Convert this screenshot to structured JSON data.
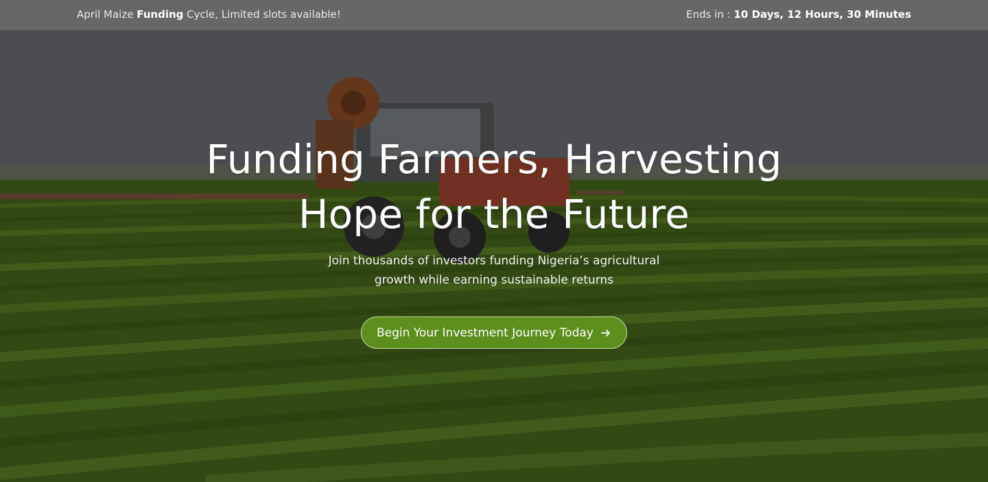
{
  "announcement": {
    "left_prefix": "April Maize ",
    "left_bold": "Funding",
    "left_suffix": " Cycle, Limited slots available!",
    "right_label": "Ends in : ",
    "right_value": "10 Days, 12 Hours, 30 Minutes"
  },
  "hero": {
    "headline_line1": "Funding Farmers, Harvesting",
    "headline_line2": "Hope for the Future",
    "subtext_line1": "Join thousands of investors funding Nigeria’s agricultural",
    "subtext_line2": "growth while earning sustainable returns",
    "cta_label": "Begin Your Investment Journey Today",
    "cta_icon": "arrow-right-icon",
    "background_image": "tractor-in-crop-field",
    "accent_color": "#5d8f1d"
  }
}
